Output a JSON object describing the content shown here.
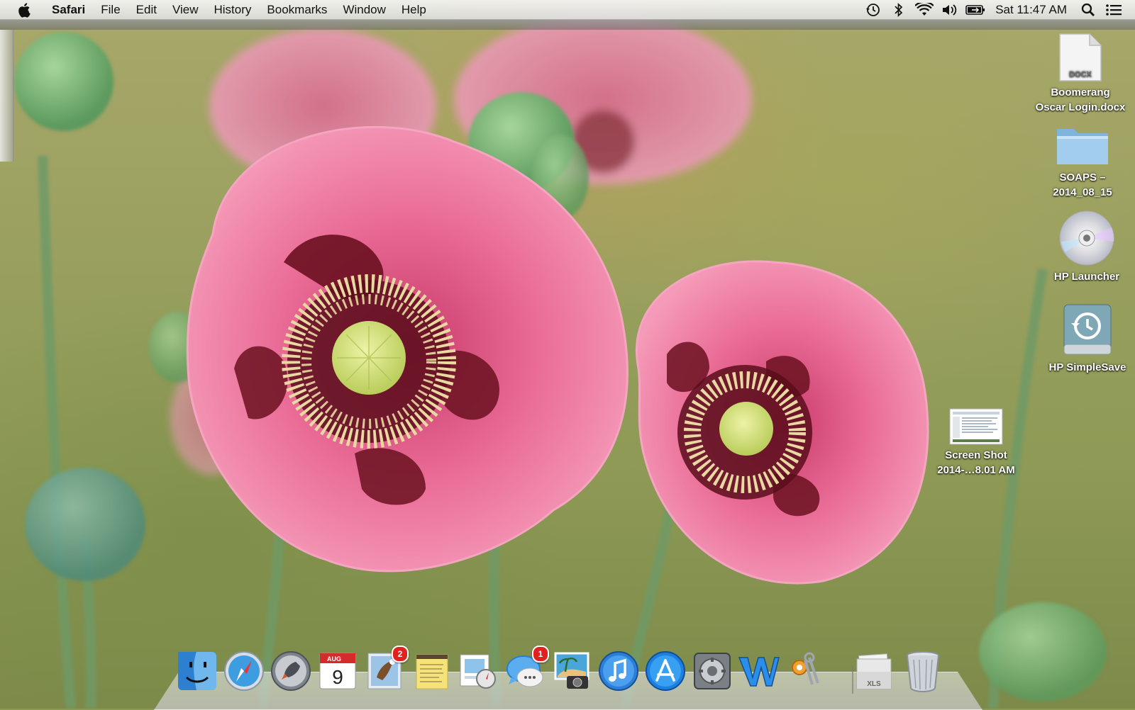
{
  "menubar": {
    "app_name": "Safari",
    "menus": [
      "File",
      "Edit",
      "View",
      "History",
      "Bookmarks",
      "Window",
      "Help"
    ],
    "status_icons": [
      "time-machine-icon",
      "bluetooth-icon",
      "wifi-icon",
      "volume-icon",
      "battery-icon"
    ],
    "clock": "Sat 11:47 AM"
  },
  "desktop": {
    "icons": [
      {
        "name": "Boomerang Oscar Login.docx",
        "line1": "Boomerang",
        "line2": "Oscar Login.docx",
        "type": "docx-file-icon",
        "badge_text": "DOCX"
      },
      {
        "name": "SOAPS – 2014_08_15",
        "line1": "SOAPS –",
        "line2": "2014_08_15",
        "type": "folder-icon"
      },
      {
        "name": "HP Launcher",
        "line1": "HP Launcher",
        "line2": "",
        "type": "cd-disc-icon"
      },
      {
        "name": "HP SimpleSave",
        "line1": "HP SimpleSave",
        "line2": "",
        "type": "external-drive-icon"
      },
      {
        "name": "Screen Shot 2014-…8.01 AM",
        "line1": "Screen Shot",
        "line2": "2014-…8.01 AM",
        "type": "screenshot-file-icon"
      }
    ]
  },
  "dock": {
    "items": [
      {
        "name": "Finder",
        "icon": "finder-icon"
      },
      {
        "name": "Safari",
        "icon": "safari-icon"
      },
      {
        "name": "Launchpad",
        "icon": "launchpad-icon"
      },
      {
        "name": "Calendar",
        "icon": "calendar-icon",
        "month": "AUG",
        "day": "9"
      },
      {
        "name": "Mail",
        "icon": "mail-icon",
        "badge": "2"
      },
      {
        "name": "Stickies",
        "icon": "stickies-icon"
      },
      {
        "name": "Preview",
        "icon": "preview-icon"
      },
      {
        "name": "Messages",
        "icon": "messages-icon",
        "badge": "1"
      },
      {
        "name": "iPhoto",
        "icon": "iphoto-icon"
      },
      {
        "name": "iTunes",
        "icon": "itunes-icon"
      },
      {
        "name": "App Store",
        "icon": "app-store-icon"
      },
      {
        "name": "System Preferences",
        "icon": "system-preferences-icon"
      },
      {
        "name": "Microsoft Word",
        "icon": "word-icon"
      },
      {
        "name": "Keychain Access",
        "icon": "keychain-icon"
      },
      {
        "name": "Documents",
        "icon": "xls-stack-icon",
        "stack_label": "XLS"
      },
      {
        "name": "Trash",
        "icon": "trash-icon"
      }
    ]
  },
  "colors": {
    "poppy_pink": "#e8648f",
    "poppy_center": "#6b1020",
    "stamen": "#e9d9a6",
    "pod_green": "#7dbb78",
    "badge_red": "#e0211d"
  }
}
